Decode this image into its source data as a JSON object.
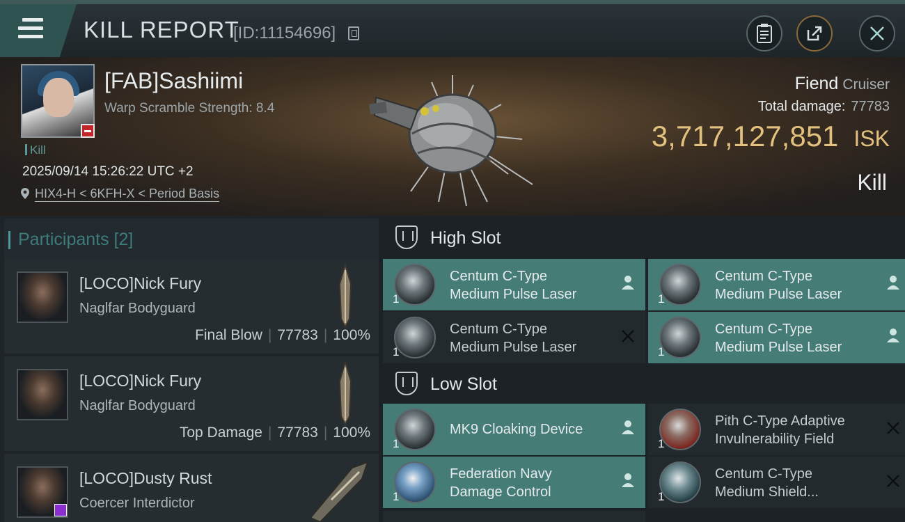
{
  "header": {
    "title": "KILL REPORT",
    "id_text": "[ID:11154696]"
  },
  "victim": {
    "name": "[FAB]Sashiimi",
    "warp_scramble": "Warp Scramble Strength: 8.4",
    "kill_tag": "Kill",
    "datetime": "2025/09/14 15:26:22 UTC +2",
    "location": "HIX4-H < 6KFH-X < Period Basis"
  },
  "ship": {
    "name": "Fiend",
    "class": "Cruiser",
    "total_damage_label": "Total damage:",
    "total_damage_value": "77783",
    "isk_value": "3,717,127,851",
    "isk_unit": "ISK",
    "result": "Kill"
  },
  "participants": {
    "title": "Participants [2]",
    "rows": [
      {
        "name": "[LOCO]Nick Fury",
        "ship": "Naglfar Bodyguard",
        "stat_label": "Final Blow",
        "damage": "77783",
        "percent": "100%"
      },
      {
        "name": "[LOCO]Nick Fury",
        "ship": "Naglfar Bodyguard",
        "stat_label": "Top Damage",
        "damage": "77783",
        "percent": "100%"
      },
      {
        "name": "[LOCO]Dusty Rust",
        "ship": "Coercer Interdictor"
      }
    ]
  },
  "slots": {
    "high": {
      "label": "High Slot",
      "modules": [
        {
          "line1": "Centum C-Type",
          "line2": "Medium Pulse Laser",
          "qty": "1",
          "status": "person-icon"
        },
        {
          "line1": "Centum C-Type",
          "line2": "Medium Pulse Laser",
          "qty": "1",
          "status": "person-icon"
        },
        {
          "line1": "Centum C-Type",
          "line2": "Medium Pulse Laser",
          "qty": "1",
          "status": "x-icon"
        },
        {
          "line1": "Centum C-Type",
          "line2": "Medium Pulse Laser",
          "qty": "1",
          "status": "person-icon"
        }
      ]
    },
    "low": {
      "label": "Low Slot",
      "modules": [
        {
          "line1": "MK9 Cloaking Device",
          "line2": "",
          "qty": "1",
          "status": "person-icon"
        },
        {
          "line1": "Pith C-Type Adaptive",
          "line2": "Invulnerability Field",
          "qty": "1",
          "status": "x-icon"
        },
        {
          "line1": "Federation Navy",
          "line2": "Damage Control",
          "qty": "1",
          "status": "person-icon"
        },
        {
          "line1": "Centum C-Type",
          "line2": "Medium Shield...",
          "qty": "1",
          "status": "x-icon"
        }
      ]
    }
  },
  "colors": {
    "accent_teal": "#467c76",
    "isk_gold": "#e2c07e"
  }
}
